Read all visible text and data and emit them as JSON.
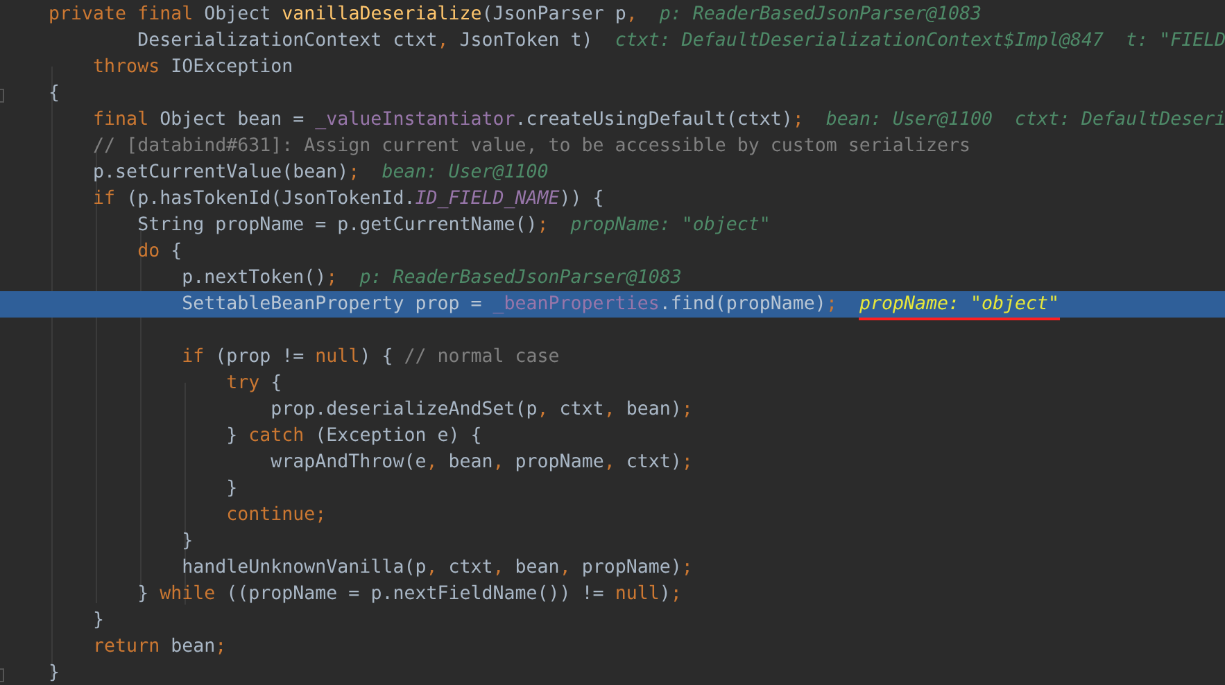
{
  "editor": {
    "lines": [
      {
        "selected": false,
        "fold_marker": false,
        "tokens": [
          {
            "kind": "kw",
            "text": "    private final "
          },
          {
            "kind": "plain",
            "text": "Object "
          },
          {
            "kind": "fn",
            "text": "vanillaDeserialize"
          },
          {
            "kind": "plain",
            "text": "(JsonParser p"
          },
          {
            "kind": "punct",
            "text": ","
          },
          {
            "kind": "value",
            "text": "p: ReaderBasedJsonParser@1083"
          }
        ]
      },
      {
        "selected": false,
        "fold_marker": false,
        "tokens": [
          {
            "kind": "plain",
            "text": "            DeserializationContext ctxt"
          },
          {
            "kind": "punct",
            "text": ","
          },
          {
            "kind": "plain",
            "text": " JsonToken t)"
          },
          {
            "kind": "value",
            "text": "ctxt: DefaultDeserializationContext$Impl@847  t: \"FIELD"
          }
        ]
      },
      {
        "selected": false,
        "fold_marker": false,
        "tokens": [
          {
            "kind": "kw",
            "text": "        throws "
          },
          {
            "kind": "plain",
            "text": "IOException"
          }
        ]
      },
      {
        "selected": false,
        "fold_marker": true,
        "tokens": [
          {
            "kind": "plain",
            "text": "    {"
          }
        ]
      },
      {
        "selected": false,
        "fold_marker": false,
        "tokens": [
          {
            "kind": "kw",
            "text": "        final "
          },
          {
            "kind": "plain",
            "text": "Object bean = "
          },
          {
            "kind": "field",
            "text": "_valueInstantiator"
          },
          {
            "kind": "plain",
            "text": ".createUsingDefault(ctxt)"
          },
          {
            "kind": "punct",
            "text": ";"
          },
          {
            "kind": "value",
            "text": "bean: User@1100  ctxt: DefaultDeseri"
          }
        ]
      },
      {
        "selected": false,
        "fold_marker": false,
        "tokens": [
          {
            "kind": "comment",
            "text": "        // [databind#631]: Assign current value, to be accessible by custom serializers"
          }
        ]
      },
      {
        "selected": false,
        "fold_marker": false,
        "tokens": [
          {
            "kind": "plain",
            "text": "        p.setCurrentValue(bean)"
          },
          {
            "kind": "punct",
            "text": ";"
          },
          {
            "kind": "value",
            "text": "bean: User@1100"
          }
        ]
      },
      {
        "selected": false,
        "fold_marker": false,
        "tokens": [
          {
            "kind": "kw",
            "text": "        if "
          },
          {
            "kind": "plain",
            "text": "(p.hasTokenId(JsonTokenId."
          },
          {
            "kind": "const",
            "text": "ID_FIELD_NAME"
          },
          {
            "kind": "plain",
            "text": ")) {"
          }
        ]
      },
      {
        "selected": false,
        "fold_marker": false,
        "tokens": [
          {
            "kind": "plain",
            "text": "            String propName = p.getCurrentName()"
          },
          {
            "kind": "punct",
            "text": ";"
          },
          {
            "kind": "value",
            "text": "propName: \"object\""
          }
        ]
      },
      {
        "selected": false,
        "fold_marker": false,
        "tokens": [
          {
            "kind": "kw",
            "text": "            do "
          },
          {
            "kind": "plain",
            "text": "{"
          }
        ]
      },
      {
        "selected": false,
        "fold_marker": false,
        "tokens": [
          {
            "kind": "plain",
            "text": "                p.nextToken()"
          },
          {
            "kind": "punct",
            "text": ";"
          },
          {
            "kind": "value",
            "text": "p: ReaderBasedJsonParser@1083"
          }
        ]
      },
      {
        "selected": true,
        "fold_marker": false,
        "tokens": [
          {
            "kind": "plain",
            "text": "                SettableBeanProperty prop = "
          },
          {
            "kind": "field",
            "text": "_beanProperties"
          },
          {
            "kind": "plain",
            "text": ".find(propName)"
          },
          {
            "kind": "punct",
            "text": ";"
          },
          {
            "kind": "value",
            "text": "propName: \"object\"",
            "underlined": true
          }
        ]
      },
      {
        "selected": false,
        "fold_marker": false
      },
      {
        "selected": false,
        "fold_marker": false,
        "tokens": [
          {
            "kind": "kw",
            "text": "                if "
          },
          {
            "kind": "plain",
            "text": "(prop != "
          },
          {
            "kind": "kw",
            "text": "null"
          },
          {
            "kind": "plain",
            "text": ") { "
          },
          {
            "kind": "comment",
            "text": "// normal case"
          }
        ]
      },
      {
        "selected": false,
        "fold_marker": false,
        "tokens": [
          {
            "kind": "kw",
            "text": "                    try "
          },
          {
            "kind": "plain",
            "text": "{"
          }
        ]
      },
      {
        "selected": false,
        "fold_marker": false,
        "tokens": [
          {
            "kind": "plain",
            "text": "                        prop.deserializeAndSet(p"
          },
          {
            "kind": "punct",
            "text": ","
          },
          {
            "kind": "plain",
            "text": " ctxt"
          },
          {
            "kind": "punct",
            "text": ","
          },
          {
            "kind": "plain",
            "text": " bean)"
          },
          {
            "kind": "punct",
            "text": ";"
          }
        ]
      },
      {
        "selected": false,
        "fold_marker": false,
        "tokens": [
          {
            "kind": "plain",
            "text": "                    } "
          },
          {
            "kind": "kw",
            "text": "catch "
          },
          {
            "kind": "plain",
            "text": "(Exception e) {"
          }
        ]
      },
      {
        "selected": false,
        "fold_marker": false,
        "tokens": [
          {
            "kind": "plain",
            "text": "                        wrapAndThrow(e"
          },
          {
            "kind": "punct",
            "text": ","
          },
          {
            "kind": "plain",
            "text": " bean"
          },
          {
            "kind": "punct",
            "text": ","
          },
          {
            "kind": "plain",
            "text": " propName"
          },
          {
            "kind": "punct",
            "text": ","
          },
          {
            "kind": "plain",
            "text": " ctxt)"
          },
          {
            "kind": "punct",
            "text": ";"
          }
        ]
      },
      {
        "selected": false,
        "fold_marker": false,
        "tokens": [
          {
            "kind": "plain",
            "text": "                    }"
          }
        ]
      },
      {
        "selected": false,
        "fold_marker": false,
        "tokens": [
          {
            "kind": "kw",
            "text": "                    continue"
          },
          {
            "kind": "punct",
            "text": ";"
          }
        ]
      },
      {
        "selected": false,
        "fold_marker": false,
        "tokens": [
          {
            "kind": "plain",
            "text": "                }"
          }
        ]
      },
      {
        "selected": false,
        "fold_marker": false,
        "tokens": [
          {
            "kind": "plain",
            "text": "                handleUnknownVanilla(p"
          },
          {
            "kind": "punct",
            "text": ","
          },
          {
            "kind": "plain",
            "text": " ctxt"
          },
          {
            "kind": "punct",
            "text": ","
          },
          {
            "kind": "plain",
            "text": " bean"
          },
          {
            "kind": "punct",
            "text": ","
          },
          {
            "kind": "plain",
            "text": " propName)"
          },
          {
            "kind": "punct",
            "text": ";"
          }
        ]
      },
      {
        "selected": false,
        "fold_marker": false,
        "tokens": [
          {
            "kind": "plain",
            "text": "            } "
          },
          {
            "kind": "kw",
            "text": "while "
          },
          {
            "kind": "plain",
            "text": "((propName = p.nextFieldName()) != "
          },
          {
            "kind": "kw",
            "text": "null"
          },
          {
            "kind": "plain",
            "text": ")"
          },
          {
            "kind": "punct",
            "text": ";"
          }
        ]
      },
      {
        "selected": false,
        "fold_marker": false,
        "tokens": [
          {
            "kind": "plain",
            "text": "        }"
          }
        ]
      },
      {
        "selected": false,
        "fold_marker": false,
        "tokens": [
          {
            "kind": "kw",
            "text": "        return "
          },
          {
            "kind": "plain",
            "text": "bean"
          },
          {
            "kind": "punct",
            "text": ";"
          }
        ]
      },
      {
        "selected": false,
        "fold_marker": true,
        "tokens": [
          {
            "kind": "plain",
            "text": "    }"
          }
        ]
      }
    ]
  }
}
